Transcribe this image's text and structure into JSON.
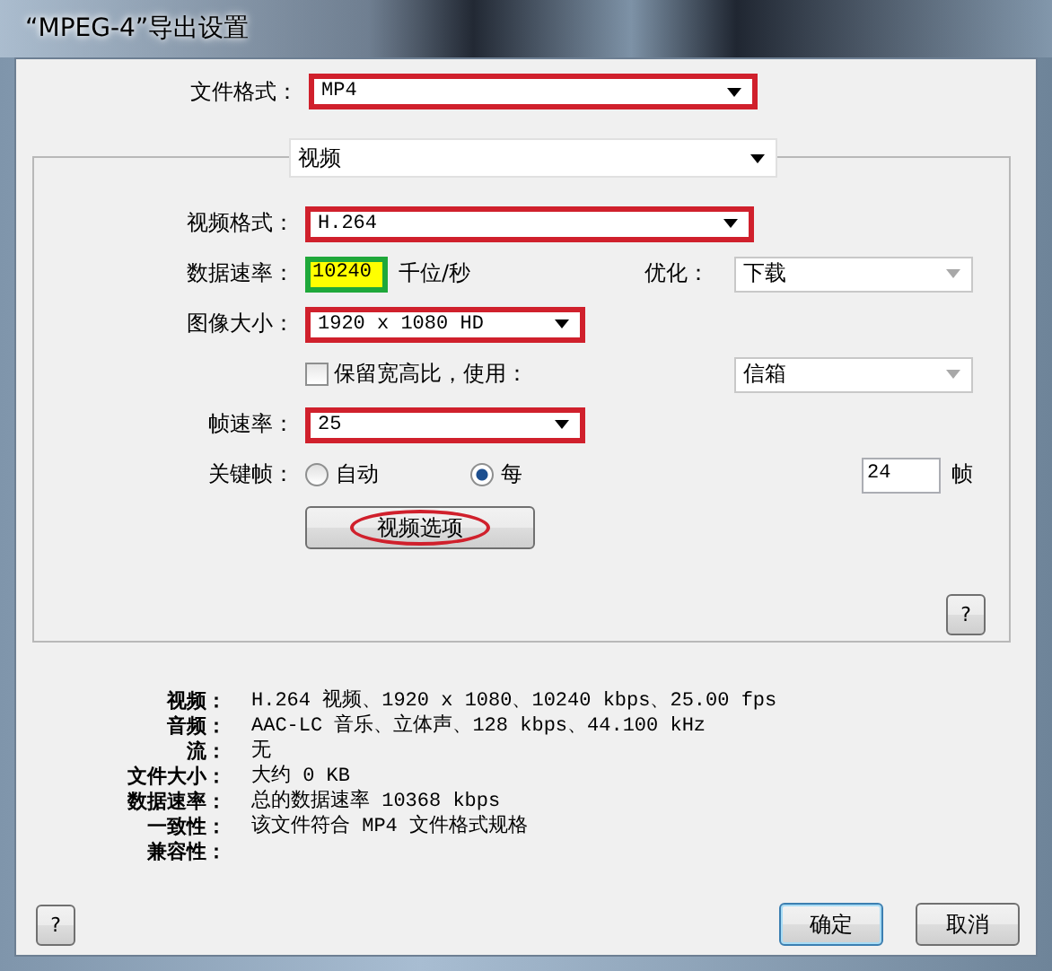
{
  "window": {
    "title": "“MPEG-4”导出设置"
  },
  "file_format": {
    "label": "文件格式：",
    "value": "MP4",
    "highlighted": true
  },
  "section": {
    "value": "视频"
  },
  "video": {
    "format": {
      "label": "视频格式：",
      "value": "H.264",
      "highlighted": true
    },
    "data_rate": {
      "label": "数据速率：",
      "value": "10240",
      "unit": "千位/秒",
      "highlighted": true
    },
    "optimize": {
      "label": "优化：",
      "value": "下载",
      "disabled": true
    },
    "image_size": {
      "label": "图像大小：",
      "value": "1920 x 1080 HD",
      "highlighted": true
    },
    "keep_aspect": {
      "label": "保留宽高比，使用：",
      "checked": false
    },
    "aspect_mode": {
      "value": "信箱",
      "disabled": true
    },
    "frame_rate": {
      "label": "帧速率：",
      "value": "25",
      "highlighted": true
    },
    "keyframes": {
      "label": "关键帧：",
      "options": [
        {
          "label": "自动",
          "selected": false
        },
        {
          "label": "每",
          "selected": true
        }
      ],
      "interval": "24",
      "unit": "帧"
    },
    "options_button": {
      "label": "视频选项",
      "highlighted": true
    },
    "help": "?"
  },
  "summary": [
    {
      "label": "视频：",
      "value": "H.264 视频、1920 x 1080、10240 kbps、25.00 fps"
    },
    {
      "label": "音频：",
      "value": "AAC-LC 音乐、立体声、128 kbps、44.100 kHz"
    },
    {
      "label": "流：",
      "value": "无"
    },
    {
      "label": "文件大小：",
      "value": "大约 0 KB"
    },
    {
      "label": "数据速率：",
      "value": "总的数据速率 10368 kbps"
    },
    {
      "label": "一致性：",
      "value": "该文件符合 MP4 文件格式规格"
    },
    {
      "label": "兼容性："
    }
  ],
  "footer": {
    "help": "?",
    "buttons": [
      {
        "label": "确定",
        "default": true
      },
      {
        "label": "取消",
        "default": false
      }
    ]
  }
}
